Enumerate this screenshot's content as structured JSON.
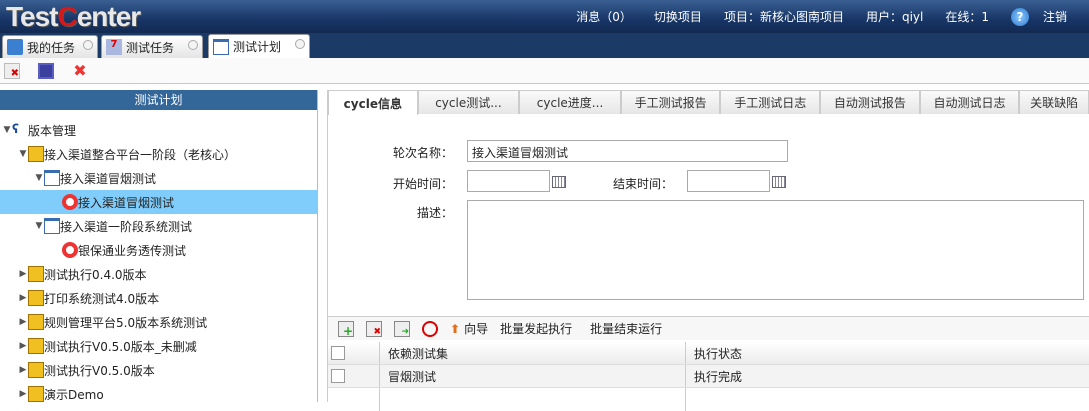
{
  "header": {
    "logo": "TestCenter",
    "messages": "消息（0）",
    "switch_project": "切换项目",
    "project": "项目：新核心图南项目",
    "user": "用户：qiyl",
    "online": "在线：1",
    "help_icon": "?",
    "logout": "注销"
  },
  "main_tabs": [
    {
      "label": "我的任务"
    },
    {
      "label": "测试任务"
    },
    {
      "label": "测试计划"
    }
  ],
  "left": {
    "title": "测试计划",
    "tree": [
      {
        "label": "版本管理"
      },
      {
        "label": "接入渠道整合平台一阶段（老核心）"
      },
      {
        "label": "接入渠道冒烟测试"
      },
      {
        "label": "接入渠道冒烟测试"
      },
      {
        "label": "接入渠道一阶段系统测试"
      },
      {
        "label": "银保通业务透传测试"
      },
      {
        "label": "测试执行0.4.0版本"
      },
      {
        "label": "打印系统测试4.0版本"
      },
      {
        "label": "规则管理平台5.0版本系统测试"
      },
      {
        "label": "测试执行V0.5.0版本_未删减"
      },
      {
        "label": "测试执行V0.5.0版本"
      },
      {
        "label": "演示Demo"
      }
    ]
  },
  "panel_tabs": [
    "cycle信息",
    "cycle测试...",
    "cycle进度...",
    "手工测试报告",
    "手工测试日志",
    "自动测试报告",
    "自动测试日志",
    "关联缺陷"
  ],
  "form": {
    "name_label": "轮次名称：",
    "name_value": "接入渠道冒烟测试",
    "start_label": "开始时间：",
    "start_value": "",
    "end_label": "结束时间：",
    "end_value": "",
    "desc_label": "描述：",
    "desc_value": ""
  },
  "grid_toolbar": {
    "wizard": "向导",
    "batch_start": "批量发起执行",
    "batch_end": "批量结束运行"
  },
  "grid": {
    "columns": [
      "依赖测试集",
      "执行状态"
    ],
    "rows": [
      {
        "set": "冒烟测试",
        "status": "执行完成"
      }
    ]
  }
}
